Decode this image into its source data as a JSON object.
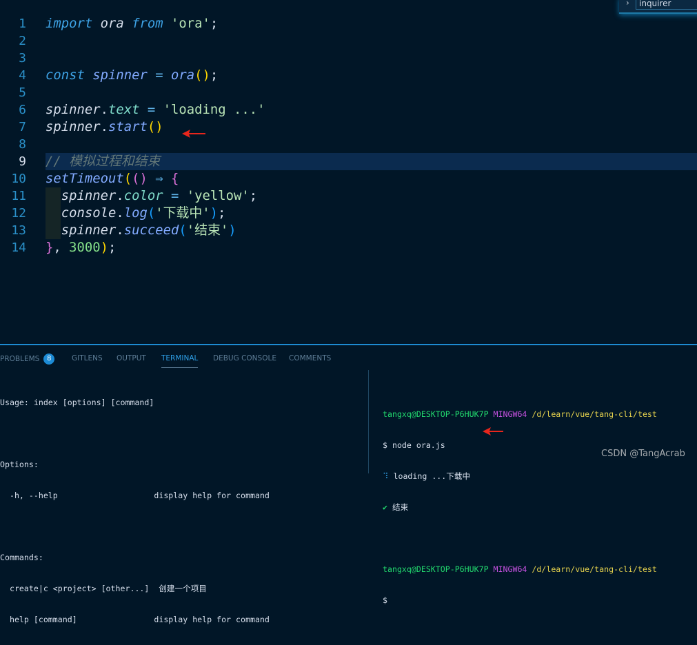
{
  "editor": {
    "current_line": 9,
    "lines": [
      {
        "n": "1",
        "tokens": [
          [
            "import",
            "kw"
          ],
          [
            " ",
            "punc"
          ],
          [
            "ora",
            "var"
          ],
          [
            " ",
            "punc"
          ],
          [
            "from",
            "kw"
          ],
          [
            " ",
            "punc"
          ],
          [
            "'ora'",
            "str"
          ],
          [
            ";",
            "punc"
          ]
        ]
      },
      {
        "n": "2",
        "tokens": []
      },
      {
        "n": "3",
        "tokens": []
      },
      {
        "n": "4",
        "tokens": [
          [
            "const",
            "kw"
          ],
          [
            " ",
            "punc"
          ],
          [
            "spinner",
            "fn"
          ],
          [
            " ",
            "punc"
          ],
          [
            "=",
            "op"
          ],
          [
            " ",
            "punc"
          ],
          [
            "ora",
            "fn"
          ],
          [
            "()",
            "p1"
          ],
          [
            ";",
            "punc"
          ]
        ]
      },
      {
        "n": "5",
        "tokens": []
      },
      {
        "n": "6",
        "tokens": [
          [
            "spinner",
            "var"
          ],
          [
            ".",
            "punc"
          ],
          [
            "text",
            "prop"
          ],
          [
            " ",
            "punc"
          ],
          [
            "=",
            "op"
          ],
          [
            " ",
            "punc"
          ],
          [
            "'loading ...'",
            "str"
          ]
        ]
      },
      {
        "n": "7",
        "tokens": [
          [
            "spinner",
            "var"
          ],
          [
            ".",
            "punc"
          ],
          [
            "start",
            "fn"
          ],
          [
            "()",
            "p1"
          ]
        ]
      },
      {
        "n": "8",
        "tokens": []
      },
      {
        "n": "9",
        "tokens": [
          [
            "// 模拟过程和结束",
            "cm"
          ]
        ]
      },
      {
        "n": "10",
        "tokens": [
          [
            "setTimeout",
            "fn"
          ],
          [
            "(",
            "p1"
          ],
          [
            "()",
            "p2"
          ],
          [
            " ",
            "punc"
          ],
          [
            "⇒",
            "op"
          ],
          [
            " ",
            "punc"
          ],
          [
            "{",
            "p2"
          ]
        ]
      },
      {
        "n": "11",
        "indent": true,
        "tokens": [
          [
            "  ",
            "punc"
          ],
          [
            "spinner",
            "var"
          ],
          [
            ".",
            "punc"
          ],
          [
            "color",
            "prop"
          ],
          [
            " ",
            "punc"
          ],
          [
            "=",
            "op"
          ],
          [
            " ",
            "punc"
          ],
          [
            "'yellow'",
            "str"
          ],
          [
            ";",
            "punc"
          ]
        ]
      },
      {
        "n": "12",
        "indent": true,
        "tokens": [
          [
            "  ",
            "punc"
          ],
          [
            "console",
            "var"
          ],
          [
            ".",
            "punc"
          ],
          [
            "log",
            "fn"
          ],
          [
            "(",
            "p3"
          ],
          [
            "'下载中'",
            "str"
          ],
          [
            ")",
            "p3"
          ],
          [
            ";",
            "punc"
          ]
        ]
      },
      {
        "n": "13",
        "indent": true,
        "tokens": [
          [
            "  ",
            "punc"
          ],
          [
            "spinner",
            "var"
          ],
          [
            ".",
            "punc"
          ],
          [
            "succeed",
            "fn"
          ],
          [
            "(",
            "p3"
          ],
          [
            "'结束'",
            "str"
          ],
          [
            ")",
            "p3"
          ]
        ]
      },
      {
        "n": "14",
        "tokens": [
          [
            "}",
            "p2"
          ],
          [
            ", ",
            "punc"
          ],
          [
            "3000",
            "num"
          ],
          [
            ")",
            "p1"
          ],
          [
            ";",
            "punc"
          ]
        ]
      }
    ]
  },
  "outline_widget": {
    "chevron_icon": "chevron-right-icon",
    "label": "inquirer"
  },
  "panel": {
    "tabs": [
      {
        "label": "PROBLEMS",
        "badge": "8"
      },
      {
        "label": "GITLENS"
      },
      {
        "label": "OUTPUT"
      },
      {
        "label": "TERMINAL",
        "active": true
      },
      {
        "label": "DEBUG CONSOLE"
      },
      {
        "label": "COMMENTS"
      }
    ],
    "terminal_left": [
      "Usage: index [options] [command]",
      "",
      "Options:",
      "  -h, --help                    display help for command",
      "",
      "Commands:",
      "  create|c <project> [other...]  创建一个项目",
      "  help [command]                display help for command"
    ],
    "terminal_right": {
      "prompt1": {
        "user": "tangxq@DESKTOP-P6HUK7P",
        "env": "MINGW64",
        "path": "/d/learn/vue/tang-cli/test"
      },
      "command": "$ node ora.js",
      "spinner_glyph": "⠹",
      "loading_line": "loading ...下载中",
      "success_glyph": "✔",
      "success_text": "结束",
      "prompt2": {
        "user": "tangxq@DESKTOP-P6HUK7P",
        "env": "MINGW64",
        "path": "/d/learn/vue/tang-cli/test"
      },
      "prompt_symbol": "$"
    }
  },
  "watermark": "CSDN @TangAcrab",
  "colors": {
    "background": "#011627",
    "accent": "#1d8bd1",
    "annotation_arrow": "#e8261c",
    "success": "#22da6e"
  }
}
